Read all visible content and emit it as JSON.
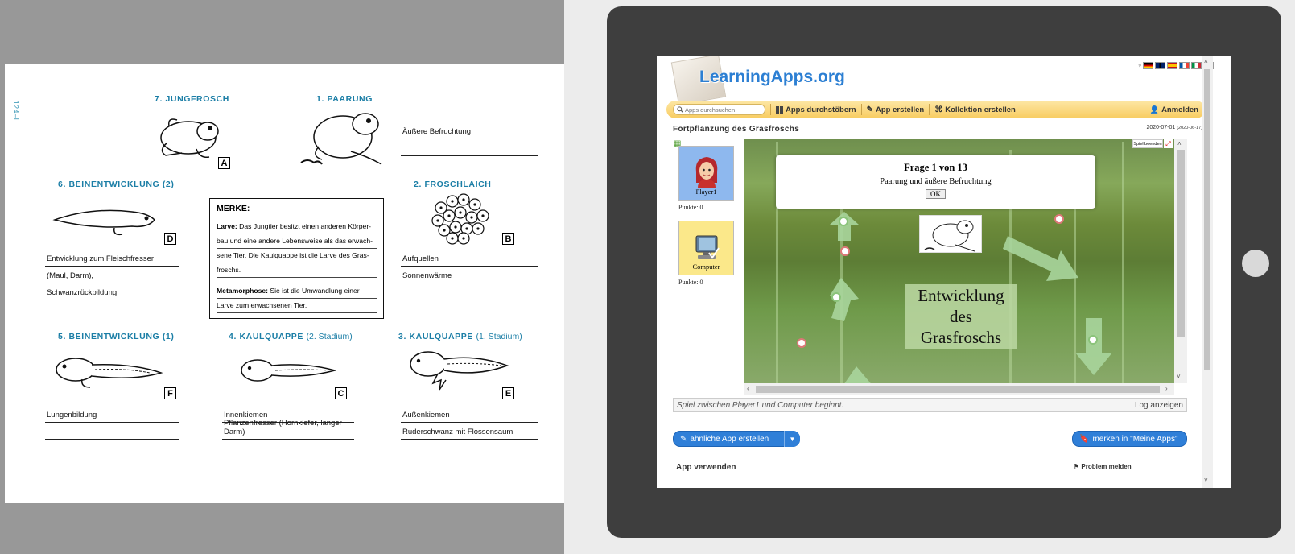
{
  "worksheet": {
    "page_number": "124–L",
    "stages": {
      "jungfrosch": "7. JUNGFROSCH",
      "paarung": "1. PAARUNG",
      "beinentwicklung2": "6. BEINENTWICKLUNG (2)",
      "froschlaich": "2. FROSCHLAICH",
      "beinentwicklung1": "5. BEINENTWICKLUNG (1)",
      "kaulquappe2_main": "4. KAULQUAPPE",
      "kaulquappe2_sub": "(2. Stadium)",
      "kaulquappe1_main": "3. KAULQUAPPE",
      "kaulquappe1_sub": "(1. Stadium)"
    },
    "letters": {
      "jungfrosch": "A",
      "froschlaich": "B",
      "kaulquappe2": "C",
      "beinentwicklung2": "D",
      "kaulquappe1": "E",
      "beinentwicklung1": "F"
    },
    "answers": {
      "paarung": [
        "Äußere Befruchtung",
        ""
      ],
      "beinentwicklung2": [
        "Entwicklung zum Fleischfresser",
        "(Maul, Darm),",
        "Schwanzrückbildung"
      ],
      "froschlaich": [
        "Aufquellen",
        "Sonnenwärme",
        ""
      ],
      "beinentwicklung1": [
        "Lungenbildung",
        ""
      ],
      "kaulquappe2": [
        "Innenkiemen",
        "Pflanzenfresser (Hornkiefer, langer Darm)"
      ],
      "kaulquappe1": [
        "Außenkiemen",
        "Ruderschwanz mit Flossensaum"
      ]
    },
    "merke": {
      "title": "MERKE:",
      "larve_term": "Larve:",
      "larve_lines": [
        " Das Jungtier besitzt einen anderen Körper-",
        "bau und eine andere Lebensweise als das erwach-",
        "sene Tier. Die Kaulquappe ist die Larve des Gras-",
        "froschs."
      ],
      "meta_term": "Metamorphose:",
      "meta_lines": [
        " Sie ist die Umwandlung einer",
        "Larve zum erwachsenen Tier."
      ]
    }
  },
  "learningapps": {
    "logo": "LearningApps.org",
    "search_placeholder": "Apps durchsuchen",
    "nav": {
      "browse": "Apps durchstöbern",
      "create": "App erstellen",
      "collection": "Kollektion erstellen",
      "login": "Anmelden"
    },
    "app_title": "Fortpflanzung des Grasfroschs",
    "app_date": "2020-07-01",
    "app_date_small": "(2020-06-17)",
    "players": [
      {
        "name": "Player1",
        "points": "Punkte: 0"
      },
      {
        "name": "Computer",
        "points": "Punkte: 0"
      }
    ],
    "exit_label": "Spiel beenden",
    "dialog": {
      "question": "Frage 1 von 13",
      "text": "Paarung und äußere Befruchtung",
      "ok": "OK"
    },
    "center_card": [
      "Entwicklung",
      "des",
      "Grasfroschs"
    ],
    "log_status": "Spiel zwischen Player1 und Computer beginnt.",
    "log_button": "Log anzeigen",
    "similar_button": "ähnliche App erstellen",
    "remember_button": "merken in \"Meine Apps\"",
    "use_app": "App verwenden",
    "problem": "Problem melden",
    "colors": {
      "accent_blue": "#2f7fd8",
      "nav_yellow": "#f8cc60",
      "title_teal": "#1b7ea6"
    }
  }
}
